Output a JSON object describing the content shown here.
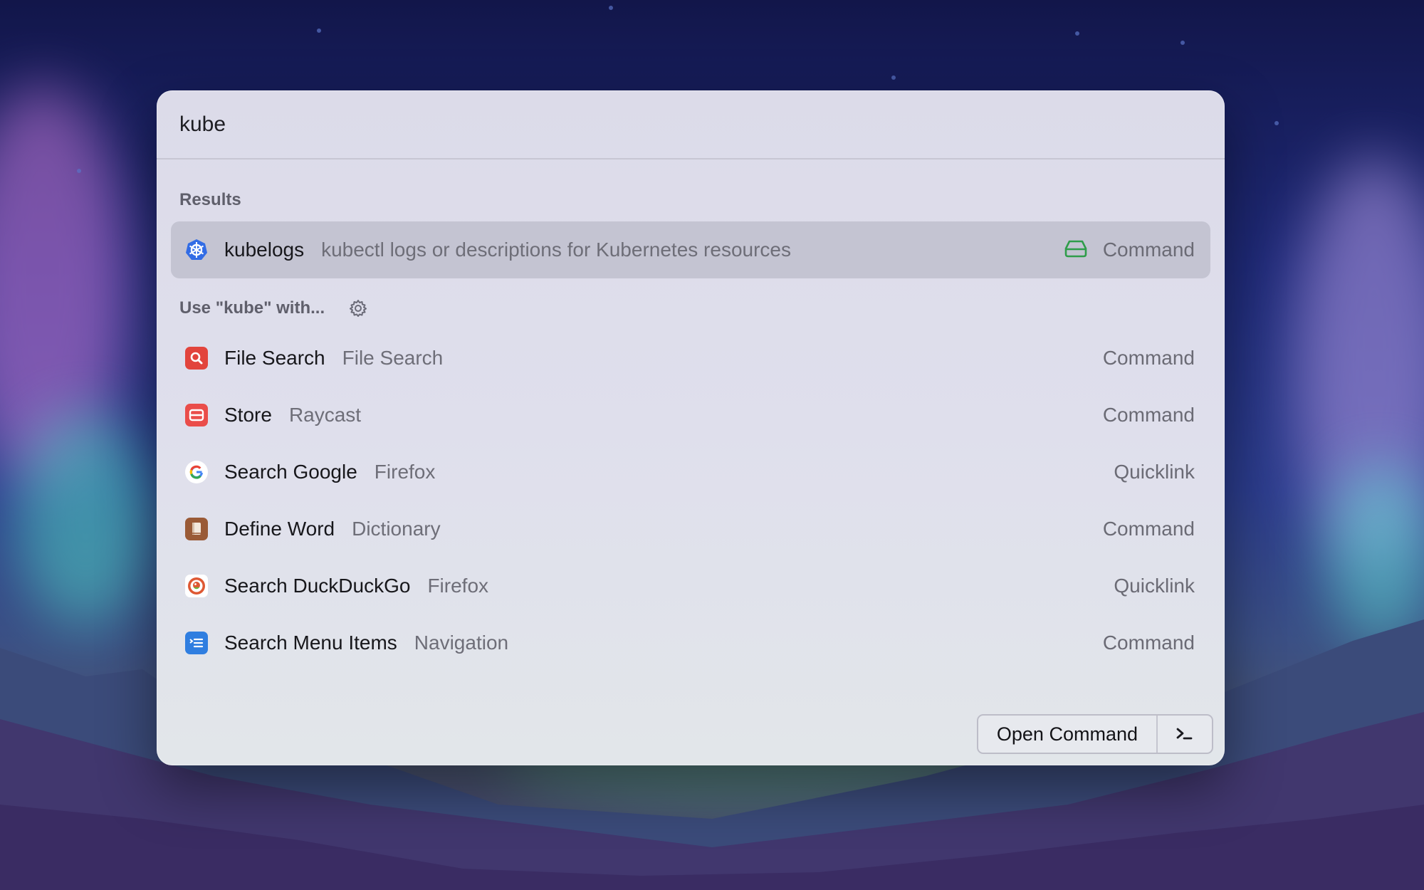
{
  "search": {
    "query": "kube"
  },
  "results": {
    "title": "Results",
    "item": {
      "title": "kubelogs",
      "subtitle": "kubectl logs or descriptions for Kubernetes resources",
      "accessory": "Command",
      "icon": "kubernetes-icon",
      "accessory_icon": "storage-icon"
    }
  },
  "fallback": {
    "title": "Use \"kube\" with...",
    "settings_icon": "gear-icon",
    "items": [
      {
        "title": "File Search",
        "subtitle": "File Search",
        "accessory": "Command",
        "icon": "file-search-icon"
      },
      {
        "title": "Store",
        "subtitle": "Raycast",
        "accessory": "Command",
        "icon": "store-icon"
      },
      {
        "title": "Search Google",
        "subtitle": "Firefox",
        "accessory": "Quicklink",
        "icon": "google-icon"
      },
      {
        "title": "Define Word",
        "subtitle": "Dictionary",
        "accessory": "Command",
        "icon": "dictionary-icon"
      },
      {
        "title": "Search DuckDuckGo",
        "subtitle": "Firefox",
        "accessory": "Quicklink",
        "icon": "duckduckgo-icon"
      },
      {
        "title": "Search Menu Items",
        "subtitle": "Navigation",
        "accessory": "Command",
        "icon": "menu-items-icon"
      }
    ]
  },
  "action_bar": {
    "primary_label": "Open Command",
    "secondary_icon": "terminal-icon"
  },
  "colors": {
    "selected_row": "#c4c4d2",
    "storage_icon": "#2f9d4a"
  }
}
